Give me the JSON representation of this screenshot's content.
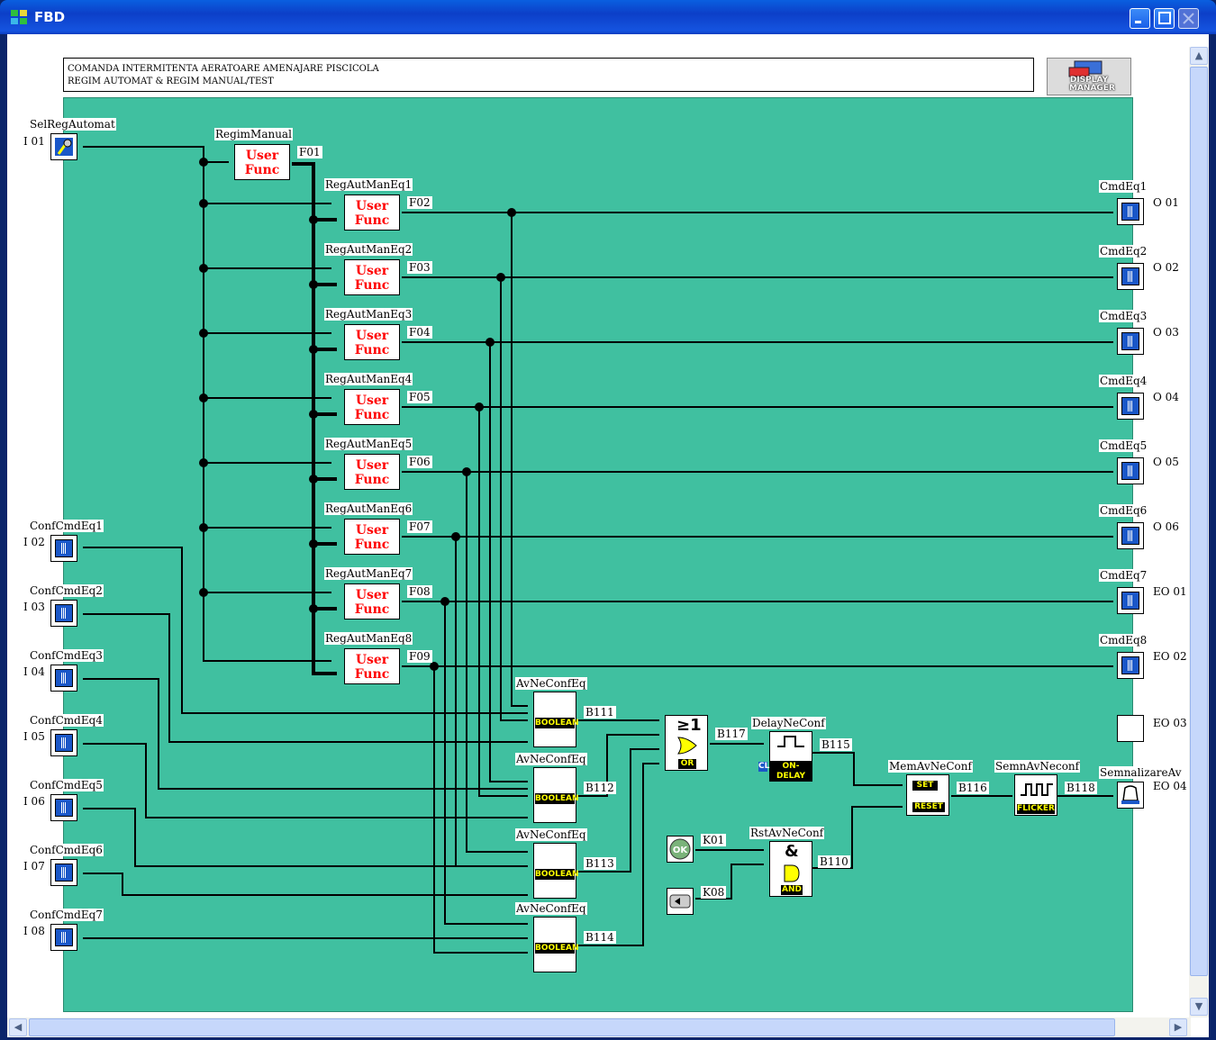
{
  "window": {
    "title": "FBD"
  },
  "comment": {
    "text": "COMANDA INTERMITENTA AERATOARE AMENAJARE PISCICOLA\nREGIM AUTOMAT & REGIM MANUAL/TEST"
  },
  "display_manager": {
    "label": "DISPLAY\nMANAGER"
  },
  "inputs": [
    {
      "name": "SelRegAutomat",
      "addr": "I 01"
    },
    {
      "name": "ConfCmdEq1",
      "addr": "I 02"
    },
    {
      "name": "ConfCmdEq2",
      "addr": "I 03"
    },
    {
      "name": "ConfCmdEq3",
      "addr": "I 04"
    },
    {
      "name": "ConfCmdEq4",
      "addr": "I 05"
    },
    {
      "name": "ConfCmdEq5",
      "addr": "I 06"
    },
    {
      "name": "ConfCmdEq6",
      "addr": "I 07"
    },
    {
      "name": "ConfCmdEq7",
      "addr": "I 08"
    }
  ],
  "user_funcs": [
    {
      "name": "RegimManual",
      "id": "F01",
      "text1": "User",
      "text2": "Func"
    },
    {
      "name": "RegAutManEq1",
      "id": "F02",
      "text1": "User",
      "text2": "Func"
    },
    {
      "name": "RegAutManEq2",
      "id": "F03",
      "text1": "User",
      "text2": "Func"
    },
    {
      "name": "RegAutManEq3",
      "id": "F04",
      "text1": "User",
      "text2": "Func"
    },
    {
      "name": "RegAutManEq4",
      "id": "F05",
      "text1": "User",
      "text2": "Func"
    },
    {
      "name": "RegAutManEq5",
      "id": "F06",
      "text1": "User",
      "text2": "Func"
    },
    {
      "name": "RegAutManEq6",
      "id": "F07",
      "text1": "User",
      "text2": "Func"
    },
    {
      "name": "RegAutManEq7",
      "id": "F08",
      "text1": "User",
      "text2": "Func"
    },
    {
      "name": "RegAutManEq8",
      "id": "F09",
      "text1": "User",
      "text2": "Func"
    }
  ],
  "outputs": [
    {
      "name": "CmdEq1",
      "addr": "O 01"
    },
    {
      "name": "CmdEq2",
      "addr": "O 02"
    },
    {
      "name": "CmdEq3",
      "addr": "O 03"
    },
    {
      "name": "CmdEq4",
      "addr": "O 04"
    },
    {
      "name": "CmdEq5",
      "addr": "O 05"
    },
    {
      "name": "CmdEq6",
      "addr": "O 06"
    },
    {
      "name": "CmdEq7",
      "addr": "EO 01"
    },
    {
      "name": "CmdEq8",
      "addr": "EO 02"
    },
    {
      "name": "",
      "addr": "EO 03"
    },
    {
      "name": "SemnalizareAv",
      "addr": "EO 04"
    }
  ],
  "boolean_blocks": [
    {
      "name": "AvNeConfEq",
      "id": "B111",
      "tag": "BOOLEAN"
    },
    {
      "name": "AvNeConfEq",
      "id": "B112",
      "tag": "BOOLEAN"
    },
    {
      "name": "AvNeConfEq",
      "id": "B113",
      "tag": "BOOLEAN"
    },
    {
      "name": "AvNeConfEq",
      "id": "B114",
      "tag": "BOOLEAN"
    }
  ],
  "or_block": {
    "id": "B117",
    "symbol": "≥1",
    "tag": "OR"
  },
  "delay_block": {
    "name": "DelayNeConf",
    "id": "B115",
    "tag": "ON-DELAY",
    "cl": "CL"
  },
  "mem_block": {
    "name": "MemAvNeConf",
    "id": "B116",
    "set": "SET",
    "reset": "RESET"
  },
  "flicker_block": {
    "name": "SemnAvNeconf",
    "id": "B118",
    "tag": "FLICKER"
  },
  "and_block": {
    "name": "RstAvNeConf",
    "id": "B110",
    "symbol": "&",
    "tag": "AND"
  },
  "keys": [
    {
      "id": "K01",
      "icon": "ok-key-icon",
      "label": "OK"
    },
    {
      "id": "K08",
      "icon": "left-arrow-key-icon"
    }
  ],
  "colors": {
    "canvas": "#40C0A0",
    "wire": "#000000",
    "user_func_text": "#FF0000",
    "io_blue": "#1A57C8",
    "tag_text": "#FFFF00"
  }
}
